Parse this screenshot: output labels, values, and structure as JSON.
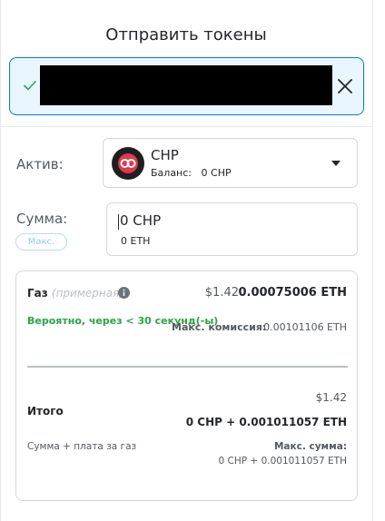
{
  "title": "Отправить токены",
  "recipient": {
    "check_icon": "check-icon",
    "close_icon": "close-icon",
    "status_color": "#037dd6"
  },
  "asset": {
    "label": "Актив:",
    "symbol": "CHP",
    "balance_label": "Баланс:",
    "balance_value": "0 CHP",
    "token_icon": "chp-token-icon"
  },
  "amount": {
    "label": "Сумма:",
    "max_button": "Макс.",
    "value": "0 CHP",
    "converted": "0 ETH"
  },
  "gas": {
    "title": "Газ",
    "estimate_note": "(примерная)",
    "fee_usd": "$1.42",
    "fee_eth": "0.00075006 ETH",
    "likely_time": "Вероятно, через < 30 секунд(-ы)",
    "max_fee_label": "Макс. комиссия:",
    "max_fee_value": "0.00101106 ETH",
    "likely_color": "#28a745"
  },
  "total": {
    "usd": "$1.42",
    "label": "Итого",
    "value": "0 CHP + 0.001011057 ETH",
    "sum_label": "Сумма + плата за газ",
    "max_sum_label": "Макс. сумма:",
    "max_sum_value": "0 CHP + 0.001011057 ETH"
  }
}
